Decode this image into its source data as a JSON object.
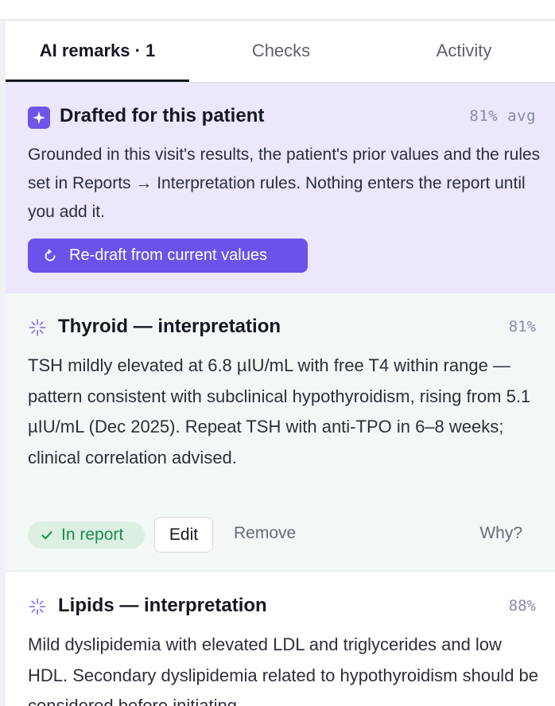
{
  "tabs": [
    {
      "label": "AI remarks · 1",
      "active": true
    },
    {
      "label": "Checks",
      "active": false
    },
    {
      "label": "Activity",
      "active": false
    }
  ],
  "banner": {
    "title": "Drafted for this patient",
    "avg": "81% avg",
    "body": "Grounded in this visit's results, the patient's prior values and the rules set in Reports → Interpretation rules. Nothing enters the report until you add it.",
    "redraft_label": "Re-draft from current values",
    "icon": "sparkle-icon",
    "bg_color": "#ece7fd",
    "accent_color": "#6b53ea"
  },
  "remarks": [
    {
      "title": "Thyroid — interpretation",
      "confidence": "81%",
      "body": "TSH mildly elevated at 6.8 µIU/mL with free T4 within range — pattern consistent with subclinical hypothyroidism, rising from 5.1 µIU/mL (Dec 2025). Repeat TSH with anti-TPO in 6–8 weeks; clinical correlation advised.",
      "status": "In report",
      "edit_label": "Edit",
      "remove_label": "Remove",
      "why_label": "Why?",
      "status_color": "#1d8a4d"
    },
    {
      "title": "Lipids — interpretation",
      "confidence": "88%",
      "body": "Mild dyslipidemia with elevated LDL and triglycerides and low HDL. Secondary dyslipidemia related to hypothyroidism should be considered before initiating"
    }
  ]
}
